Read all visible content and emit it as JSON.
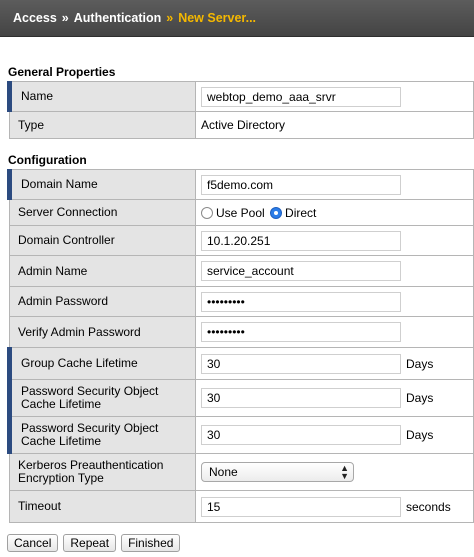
{
  "breadcrumb": {
    "items": [
      "Access",
      "Authentication"
    ],
    "separator": "»",
    "current": "New Server..."
  },
  "general": {
    "title": "General Properties",
    "name_label": "Name",
    "name_value": "webtop_demo_aaa_srvr",
    "type_label": "Type",
    "type_value": "Active Directory"
  },
  "config": {
    "title": "Configuration",
    "domain_name_label": "Domain Name",
    "domain_name_value": "f5demo.com",
    "server_connection_label": "Server Connection",
    "use_pool_label": "Use Pool",
    "direct_label": "Direct",
    "domain_controller_label": "Domain Controller",
    "domain_controller_value": "10.1.20.251",
    "admin_name_label": "Admin Name",
    "admin_name_value": "service_account",
    "admin_password_label": "Admin Password",
    "admin_password_value": "•••••••••",
    "verify_password_label": "Verify Admin Password",
    "verify_password_value": "•••••••••",
    "group_cache_label": "Group Cache Lifetime",
    "group_cache_value": "30",
    "group_cache_unit": "Days",
    "pso_cache_label_1": "Password Security Object Cache Lifetime",
    "pso_cache_value_1": "30",
    "pso_cache_unit_1": "Days",
    "pso_cache_label_2": "Password Security Object Cache Lifetime",
    "pso_cache_value_2": "30",
    "pso_cache_unit_2": "Days",
    "kerberos_label": "Kerberos Preauthentication Encryption Type",
    "kerberos_value": "None",
    "timeout_label": "Timeout",
    "timeout_value": "15",
    "timeout_unit": "seconds"
  },
  "buttons": {
    "cancel": "Cancel",
    "repeat": "Repeat",
    "finished": "Finished"
  },
  "colors": {
    "header_bg": "#4d4d4d",
    "breadcrumb_current": "#f5b800",
    "required_marker": "#2c4b80",
    "label_bg": "#e4e4e4",
    "radio_selected": "#2a7ce8"
  }
}
